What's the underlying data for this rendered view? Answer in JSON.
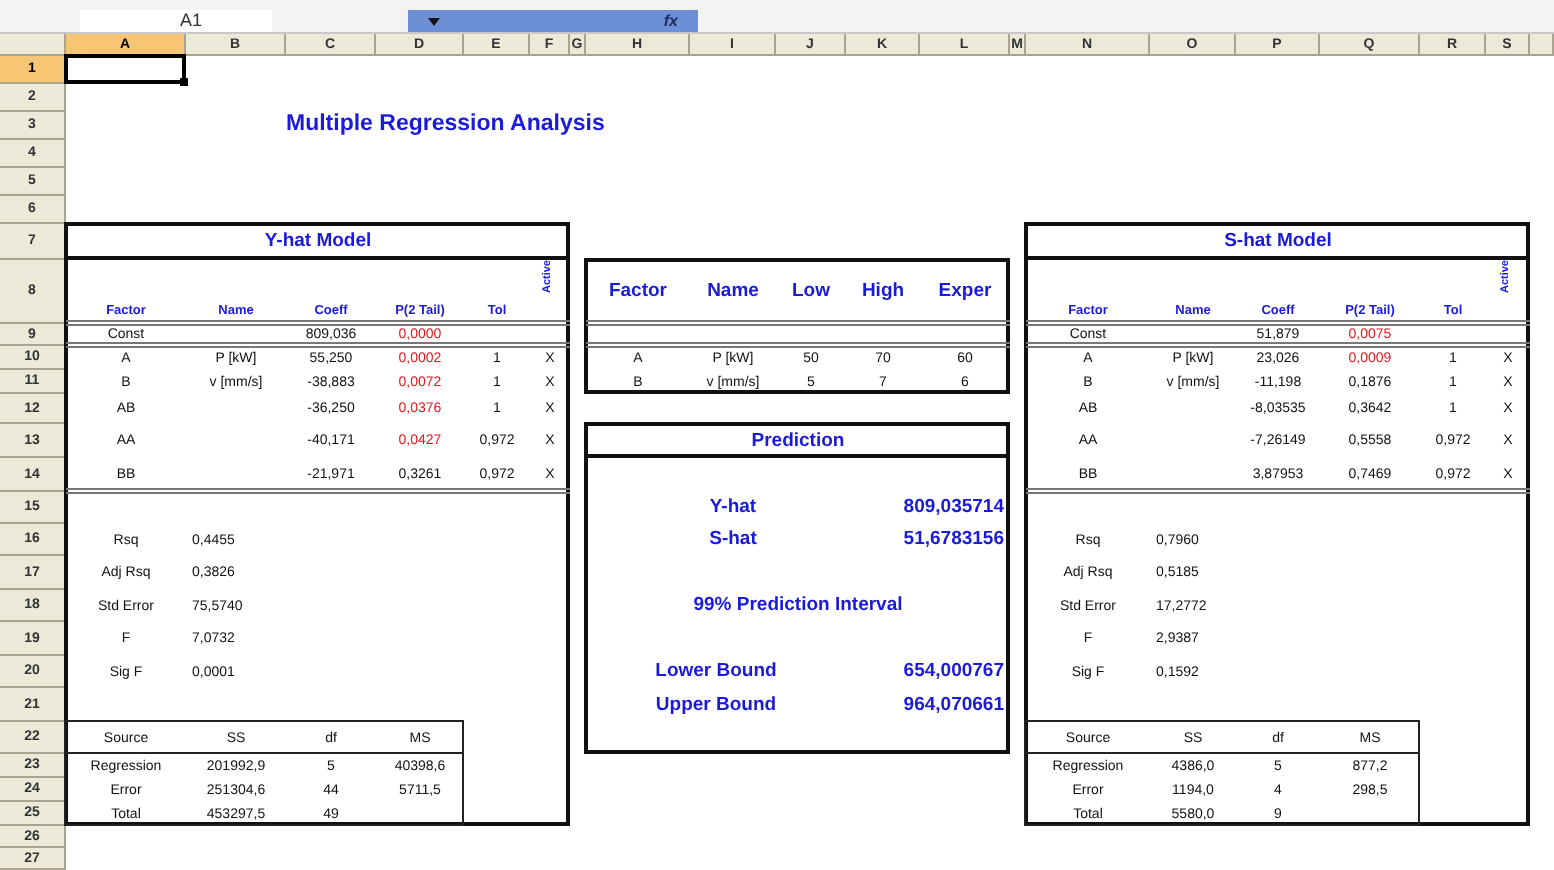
{
  "name_box": "A1",
  "formula_label": "fx",
  "columns": [
    {
      "label": "A",
      "selected": true
    },
    {
      "label": "B",
      "selected": false
    },
    {
      "label": "C",
      "selected": false
    },
    {
      "label": "D",
      "selected": false
    },
    {
      "label": "E",
      "selected": false
    },
    {
      "label": "F",
      "selected": false
    },
    {
      "label": "G",
      "selected": false
    },
    {
      "label": "H",
      "selected": false
    },
    {
      "label": "I",
      "selected": false
    },
    {
      "label": "J",
      "selected": false
    },
    {
      "label": "K",
      "selected": false
    },
    {
      "label": "L",
      "selected": false
    },
    {
      "label": "M",
      "selected": false
    },
    {
      "label": "N",
      "selected": false
    },
    {
      "label": "O",
      "selected": false
    },
    {
      "label": "P",
      "selected": false
    },
    {
      "label": "Q",
      "selected": false
    },
    {
      "label": "R",
      "selected": false
    },
    {
      "label": "S",
      "selected": false
    }
  ],
  "rows": [
    {
      "label": "1",
      "selected": true
    },
    {
      "label": "2",
      "selected": false
    },
    {
      "label": "3",
      "selected": false
    },
    {
      "label": "4",
      "selected": false
    },
    {
      "label": "5",
      "selected": false
    },
    {
      "label": "6",
      "selected": false
    },
    {
      "label": "7",
      "selected": false
    },
    {
      "label": "8",
      "selected": false
    },
    {
      "label": "9",
      "selected": false
    },
    {
      "label": "10",
      "selected": false
    },
    {
      "label": "11",
      "selected": false
    },
    {
      "label": "12",
      "selected": false
    },
    {
      "label": "13",
      "selected": false
    },
    {
      "label": "14",
      "selected": false
    },
    {
      "label": "15",
      "selected": false
    },
    {
      "label": "16",
      "selected": false
    },
    {
      "label": "17",
      "selected": false
    },
    {
      "label": "18",
      "selected": false
    },
    {
      "label": "19",
      "selected": false
    },
    {
      "label": "20",
      "selected": false
    },
    {
      "label": "21",
      "selected": false
    },
    {
      "label": "22",
      "selected": false
    },
    {
      "label": "23",
      "selected": false
    },
    {
      "label": "24",
      "selected": false
    },
    {
      "label": "25",
      "selected": false
    },
    {
      "label": "26",
      "selected": false
    },
    {
      "label": "27",
      "selected": false
    }
  ],
  "title": "Multiple Regression Analysis",
  "y_hat_model": {
    "title": "Y-hat Model",
    "headers": [
      "Factor",
      "Name",
      "Coeff",
      "P(2 Tail)",
      "Tol",
      "Active"
    ],
    "terms": [
      {
        "factor": "Const",
        "coeff": "809,036",
        "p": "0,0000",
        "significant": true
      },
      {
        "factor": "A",
        "name": "P [kW]",
        "coeff": "55,250",
        "p": "0,0002",
        "significant": true,
        "tol": "1",
        "active": "X"
      },
      {
        "factor": "B",
        "name": "v [mm/s]",
        "coeff": "-38,883",
        "p": "0,0072",
        "significant": true,
        "tol": "1",
        "active": "X"
      },
      {
        "factor": "AB",
        "coeff": "-36,250",
        "p": "0,0376",
        "significant": true,
        "tol": "1",
        "active": "X"
      },
      {
        "factor": "AA",
        "coeff": "-40,171",
        "p": "0,0427",
        "significant": true,
        "tol": "0,972",
        "active": "X"
      },
      {
        "factor": "BB",
        "coeff": "-21,971",
        "p": "0,3261",
        "significant": false,
        "tol": "0,972",
        "active": "X"
      }
    ],
    "stats": [
      {
        "label": "Rsq",
        "value": "0,4455"
      },
      {
        "label": "Adj Rsq",
        "value": "0,3826"
      },
      {
        "label": "Std Error",
        "value": "75,5740"
      },
      {
        "label": "F",
        "value": "7,0732"
      },
      {
        "label": "Sig F",
        "value": "0,0001"
      }
    ],
    "anova": {
      "headers": [
        "Source",
        "SS",
        "df",
        "MS"
      ],
      "rows": [
        [
          "Regression",
          "201992,9",
          "5",
          "40398,6"
        ],
        [
          "Error",
          "251304,6",
          "44",
          "5711,5"
        ],
        [
          "Total",
          "453297,5",
          "49"
        ]
      ]
    }
  },
  "factors": {
    "headers": [
      "Factor",
      "Name",
      "Low",
      "High",
      "Exper"
    ],
    "rows": [
      [
        "A",
        "P [kW]",
        "50",
        "70",
        "60"
      ],
      [
        "B",
        "v [mm/s]",
        "5",
        "7",
        "6"
      ]
    ]
  },
  "prediction": {
    "title": "Prediction",
    "y_hat": {
      "label": "Y-hat",
      "value": "809,035714"
    },
    "s_hat": {
      "label": "S-hat",
      "value": "51,6783156"
    },
    "interval_title": "99% Prediction Interval",
    "lower": {
      "label": "Lower Bound",
      "value": "654,000767"
    },
    "upper": {
      "label": "Upper Bound",
      "value": "964,070661"
    }
  },
  "s_hat_model": {
    "title": "S-hat Model",
    "headers": [
      "Factor",
      "Name",
      "Coeff",
      "P(2 Tail)",
      "Tol",
      "Active"
    ],
    "terms": [
      {
        "factor": "Const",
        "coeff": "51,879",
        "p": "0,0075",
        "significant": true
      },
      {
        "factor": "A",
        "name": "P [kW]",
        "coeff": "23,026",
        "p": "0,0009",
        "significant": true,
        "tol": "1",
        "active": "X"
      },
      {
        "factor": "B",
        "name": "v [mm/s]",
        "coeff": "-11,198",
        "p": "0,1876",
        "significant": false,
        "tol": "1",
        "active": "X"
      },
      {
        "factor": "AB",
        "coeff": "-8,03535",
        "p": "0,3642",
        "significant": false,
        "tol": "1",
        "active": "X"
      },
      {
        "factor": "AA",
        "coeff": "-7,26149",
        "p": "0,5558",
        "significant": false,
        "tol": "0,972",
        "active": "X"
      },
      {
        "factor": "BB",
        "coeff": "3,87953",
        "p": "0,7469",
        "significant": false,
        "tol": "0,972",
        "active": "X"
      }
    ],
    "stats": [
      {
        "label": "Rsq",
        "value": "0,7960"
      },
      {
        "label": "Adj Rsq",
        "value": "0,5185"
      },
      {
        "label": "Std Error",
        "value": "17,2772"
      },
      {
        "label": "F",
        "value": "2,9387"
      },
      {
        "label": "Sig F",
        "value": "0,1592"
      }
    ],
    "anova": {
      "headers": [
        "Source",
        "SS",
        "df",
        "MS"
      ],
      "rows": [
        [
          "Regression",
          "4386,0",
          "5",
          "877,2"
        ],
        [
          "Error",
          "1194,0",
          "4",
          "298,5"
        ],
        [
          "Total",
          "5580,0",
          "9"
        ]
      ]
    }
  }
}
